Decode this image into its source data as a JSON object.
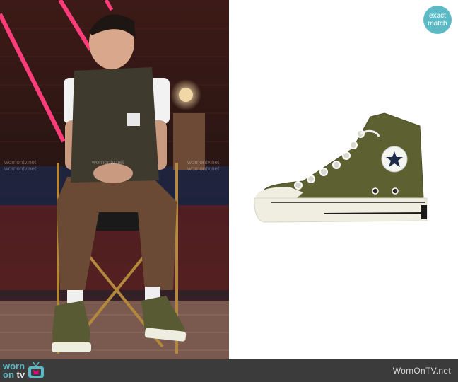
{
  "badge": {
    "line1": "exact",
    "line2": "match"
  },
  "footer": {
    "logo_worn": "worn",
    "logo_on": "on",
    "logo_tv": "tv",
    "site": "WornOnTV.net"
  },
  "watermark": {
    "text": "wornontv.net"
  },
  "colors": {
    "accent": "#5bbac6",
    "footer_bg": "#3b3b3b",
    "shoe_canvas": "#5d6132",
    "sole": "#efeee0"
  },
  "icons": {
    "logo": "tv-set-icon",
    "star": "star-icon"
  }
}
